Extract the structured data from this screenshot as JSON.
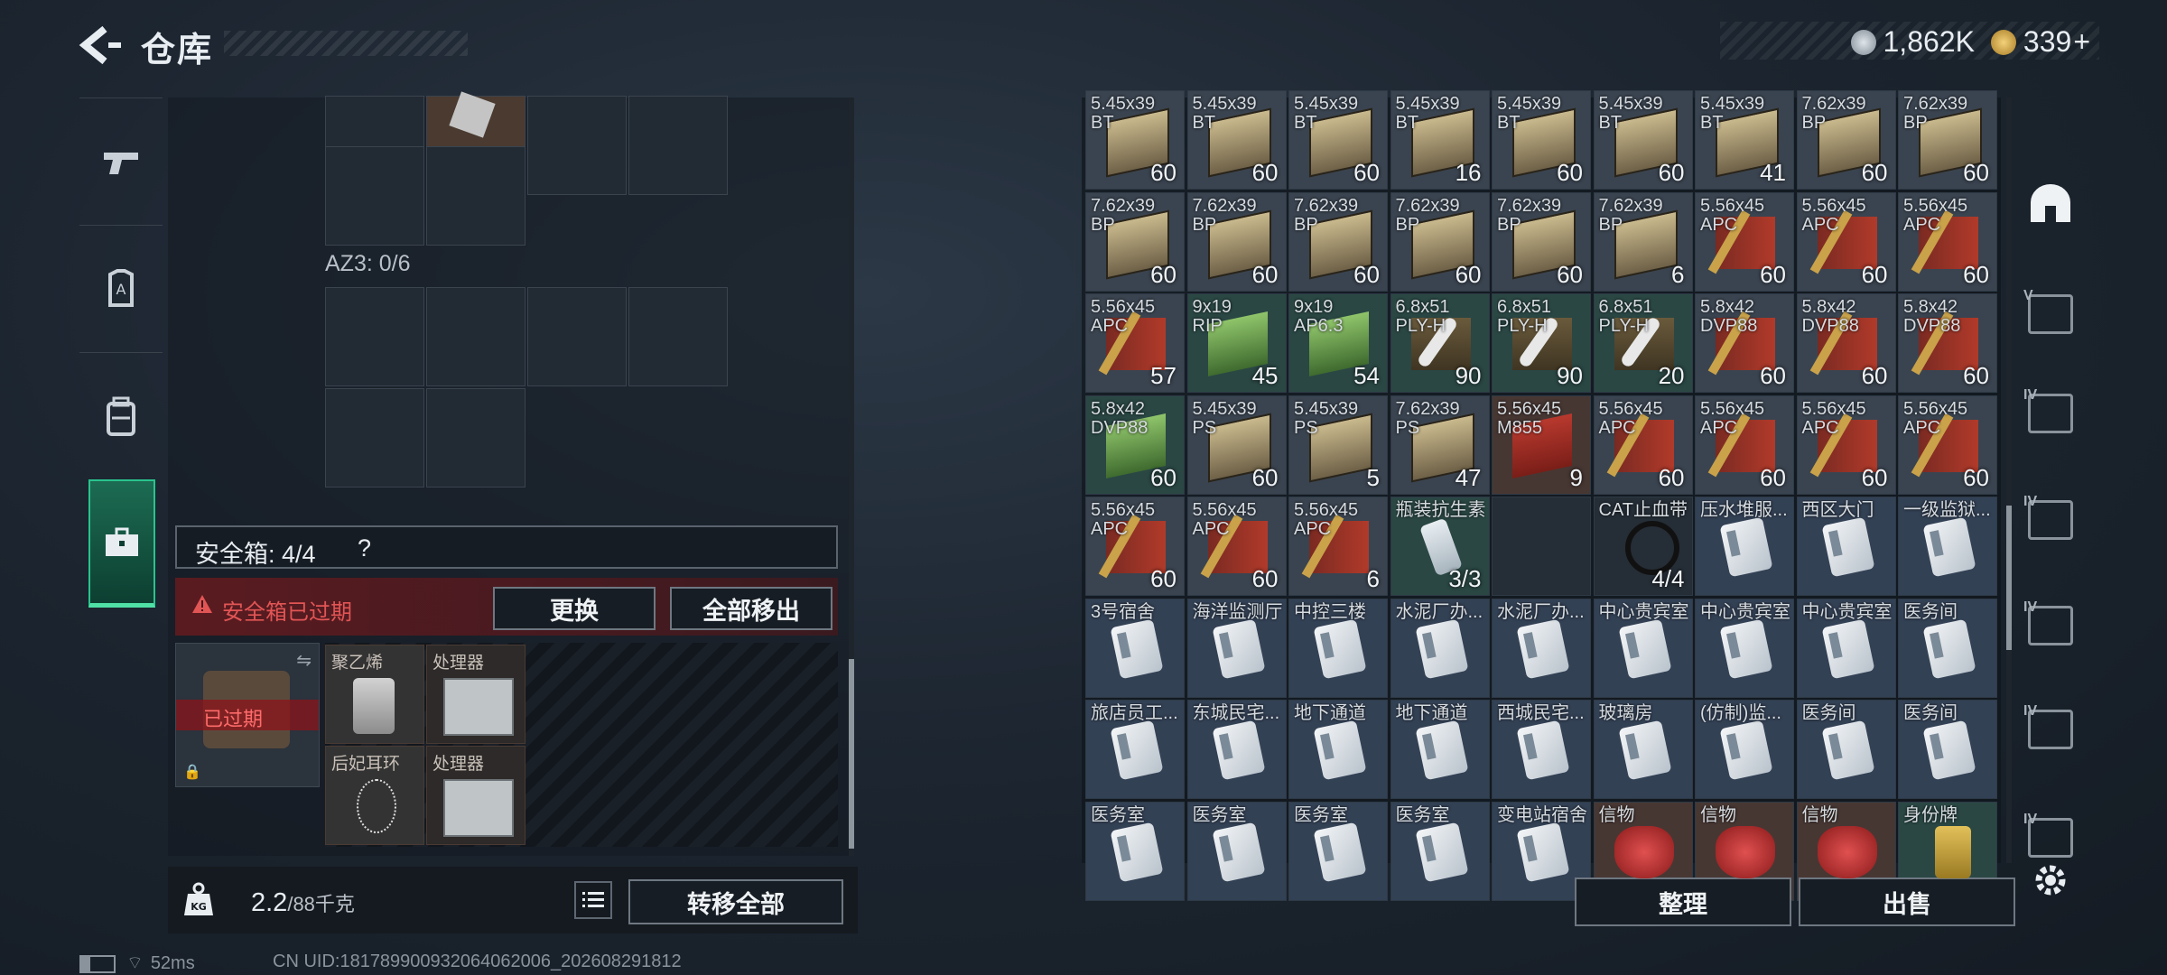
{
  "header": {
    "title": "仓库",
    "currency_1": "1,862K",
    "currency_2": "339",
    "currency_2_suffix": "+"
  },
  "left_tabs": [
    {
      "name": "tab-weapons",
      "icon": "gun-icon"
    },
    {
      "name": "tab-armor",
      "icon": "vest-icon"
    },
    {
      "name": "tab-backpack",
      "icon": "backpack-icon"
    },
    {
      "name": "tab-safe-box",
      "icon": "toolbox-icon",
      "active": true
    }
  ],
  "loadout": {
    "az3_label": "AZ3: 0/6"
  },
  "safe_box": {
    "title": "安全箱: 4/4",
    "help": "?",
    "expired_notice": "安全箱已过期",
    "replace_btn": "更换",
    "remove_all_btn": "全部移出",
    "box_status": "已过期",
    "items": [
      {
        "name": "聚乙烯"
      },
      {
        "name": "处理器"
      },
      {
        "name": "后妃耳环"
      },
      {
        "name": "处理器"
      }
    ]
  },
  "weight": {
    "current": "2.2",
    "max": "/88千克",
    "kg_label": "KG"
  },
  "transfer_all_btn": "转移全部",
  "inventory_rows": [
    [
      {
        "n": "5.45x39",
        "n2": "BT",
        "q": "60",
        "t": "ammo"
      },
      {
        "n": "5.45x39",
        "n2": "BT",
        "q": "60",
        "t": "ammo"
      },
      {
        "n": "5.45x39",
        "n2": "BT",
        "q": "60",
        "t": "ammo"
      },
      {
        "n": "5.45x39",
        "n2": "BT",
        "q": "16",
        "t": "ammo"
      },
      {
        "n": "5.45x39",
        "n2": "BT",
        "q": "60",
        "t": "ammo"
      },
      {
        "n": "5.45x39",
        "n2": "BT",
        "q": "60",
        "t": "ammo"
      },
      {
        "n": "5.45x39",
        "n2": "BT",
        "q": "41",
        "t": "ammo"
      },
      {
        "n": "7.62x39",
        "n2": "BP",
        "q": "60",
        "t": "ammo"
      },
      {
        "n": "7.62x39",
        "n2": "BP",
        "q": "60",
        "t": "ammo"
      }
    ],
    [
      {
        "n": "7.62x39",
        "n2": "BP",
        "q": "60",
        "t": "ammo"
      },
      {
        "n": "7.62x39",
        "n2": "BP",
        "q": "60",
        "t": "ammo"
      },
      {
        "n": "7.62x39",
        "n2": "BP",
        "q": "60",
        "t": "ammo"
      },
      {
        "n": "7.62x39",
        "n2": "BP",
        "q": "60",
        "t": "ammo"
      },
      {
        "n": "7.62x39",
        "n2": "BP",
        "q": "60",
        "t": "ammo"
      },
      {
        "n": "7.62x39",
        "n2": "BP",
        "q": "6",
        "t": "ammo"
      },
      {
        "n": "5.56x45",
        "n2": "APC",
        "q": "60",
        "t": "round"
      },
      {
        "n": "5.56x45",
        "n2": "APC",
        "q": "60",
        "t": "round"
      },
      {
        "n": "5.56x45",
        "n2": "APC",
        "q": "60",
        "t": "round"
      }
    ],
    [
      {
        "n": "5.56x45",
        "n2": "APC",
        "q": "57",
        "t": "round"
      },
      {
        "n": "9x19",
        "n2": "RIP",
        "q": "45",
        "t": "green"
      },
      {
        "n": "9x19",
        "n2": "AP6.3",
        "q": "54",
        "t": "green"
      },
      {
        "n": "6.8x51",
        "n2": "PLY-H",
        "q": "90",
        "t": "white"
      },
      {
        "n": "6.8x51",
        "n2": "PLY-H",
        "q": "90",
        "t": "white"
      },
      {
        "n": "6.8x51",
        "n2": "PLY-H",
        "q": "20",
        "t": "white"
      },
      {
        "n": "5.8x42",
        "n2": "DVP88",
        "q": "60",
        "t": "round"
      },
      {
        "n": "5.8x42",
        "n2": "DVP88",
        "q": "60",
        "t": "round"
      },
      {
        "n": "5.8x42",
        "n2": "DVP88",
        "q": "60",
        "t": "round"
      }
    ],
    [
      {
        "n": "5.8x42",
        "n2": "DVP88",
        "q": "60",
        "t": "green"
      },
      {
        "n": "5.45x39",
        "n2": "PS",
        "q": "60",
        "t": "ammo"
      },
      {
        "n": "5.45x39",
        "n2": "PS",
        "q": "5",
        "t": "ammo"
      },
      {
        "n": "7.62x39",
        "n2": "PS",
        "q": "47",
        "t": "ammo"
      },
      {
        "n": "5.56x45",
        "n2": "M855",
        "q": "9",
        "t": "red"
      },
      {
        "n": "5.56x45",
        "n2": "APC",
        "q": "60",
        "t": "round"
      },
      {
        "n": "5.56x45",
        "n2": "APC",
        "q": "60",
        "t": "round"
      },
      {
        "n": "5.56x45",
        "n2": "APC",
        "q": "60",
        "t": "round"
      },
      {
        "n": "5.56x45",
        "n2": "APC",
        "q": "60",
        "t": "round"
      }
    ],
    [
      {
        "n": "5.56x45",
        "n2": "APC",
        "q": "60",
        "t": "round"
      },
      {
        "n": "5.56x45",
        "n2": "APC",
        "q": "60",
        "t": "round"
      },
      {
        "n": "5.56x45",
        "n2": "APC",
        "q": "6",
        "t": "round"
      },
      {
        "n": "瓶装抗生素",
        "n2": "",
        "q": "3/3",
        "t": "bottle"
      },
      {
        "n": "",
        "n2": "",
        "q": "",
        "t": "empty"
      },
      {
        "n": "CAT止血带",
        "n2": "",
        "q": "4/4",
        "t": "tourniquet"
      },
      {
        "n": "压水堆服...",
        "n2": "",
        "q": "",
        "t": "card"
      },
      {
        "n": "西区大门",
        "n2": "",
        "q": "",
        "t": "card"
      },
      {
        "n": "一级监狱...",
        "n2": "",
        "q": "",
        "t": "card"
      }
    ],
    [
      {
        "n": "3号宿舍",
        "n2": "",
        "q": "",
        "t": "card"
      },
      {
        "n": "海洋监测厅",
        "n2": "",
        "q": "",
        "t": "card"
      },
      {
        "n": "中控三楼",
        "n2": "",
        "q": "",
        "t": "card"
      },
      {
        "n": "水泥厂办...",
        "n2": "",
        "q": "",
        "t": "card"
      },
      {
        "n": "水泥厂办...",
        "n2": "",
        "q": "",
        "t": "card"
      },
      {
        "n": "中心贵宾室",
        "n2": "",
        "q": "",
        "t": "card"
      },
      {
        "n": "中心贵宾室",
        "n2": "",
        "q": "",
        "t": "card"
      },
      {
        "n": "中心贵宾室",
        "n2": "",
        "q": "",
        "t": "card"
      },
      {
        "n": "医务间",
        "n2": "",
        "q": "",
        "t": "card"
      }
    ],
    [
      {
        "n": "旅店员工...",
        "n2": "",
        "q": "",
        "t": "card"
      },
      {
        "n": "东城民宅...",
        "n2": "",
        "q": "",
        "t": "card"
      },
      {
        "n": "地下通道",
        "n2": "",
        "q": "",
        "t": "card"
      },
      {
        "n": "地下通道",
        "n2": "",
        "q": "",
        "t": "card"
      },
      {
        "n": "西城民宅...",
        "n2": "",
        "q": "",
        "t": "card"
      },
      {
        "n": "玻璃房",
        "n2": "",
        "q": "",
        "t": "card"
      },
      {
        "n": "(仿制)监...",
        "n2": "",
        "q": "",
        "t": "card"
      },
      {
        "n": "医务间",
        "n2": "",
        "q": "",
        "t": "card"
      },
      {
        "n": "医务间",
        "n2": "",
        "q": "",
        "t": "card"
      }
    ],
    [
      {
        "n": "医务室",
        "n2": "",
        "q": "",
        "t": "card"
      },
      {
        "n": "医务室",
        "n2": "",
        "q": "",
        "t": "card"
      },
      {
        "n": "医务室",
        "n2": "",
        "q": "",
        "t": "card"
      },
      {
        "n": "医务室",
        "n2": "",
        "q": "",
        "t": "card"
      },
      {
        "n": "变电站宿舍",
        "n2": "",
        "q": "",
        "t": "card"
      },
      {
        "n": "信物",
        "n2": "",
        "q": "",
        "t": "mask"
      },
      {
        "n": "信物",
        "n2": "",
        "q": "",
        "t": "mask"
      },
      {
        "n": "信物",
        "n2": "",
        "q": "",
        "t": "mask"
      },
      {
        "n": "身份牌",
        "n2": "",
        "q": "",
        "t": "tag"
      }
    ]
  ],
  "actions": {
    "sort_btn": "整理",
    "sell_btn": "出售"
  },
  "right_tabs": [
    {
      "name": "tab-all-items",
      "icon": "home-icon",
      "label": ""
    },
    {
      "name": "tab-grade-v-a",
      "icon": "grade-v-icon",
      "label": "V"
    },
    {
      "name": "tab-grade-iv-a",
      "icon": "grade-iv-icon",
      "label": "IV"
    },
    {
      "name": "tab-grade-iv-b",
      "icon": "grade-iv-icon",
      "label": "IV"
    },
    {
      "name": "tab-grade-iv-c",
      "icon": "grade-iv-icon",
      "label": "IV"
    },
    {
      "name": "tab-grade-iv-d",
      "icon": "grade-iv-icon",
      "label": "IV"
    },
    {
      "name": "tab-grade-iv-e",
      "icon": "grade-iv-icon",
      "label": "IV"
    }
  ],
  "status": {
    "ping": "52ms",
    "uid": "CN UID:1817899009320640620​06_202608291812"
  }
}
